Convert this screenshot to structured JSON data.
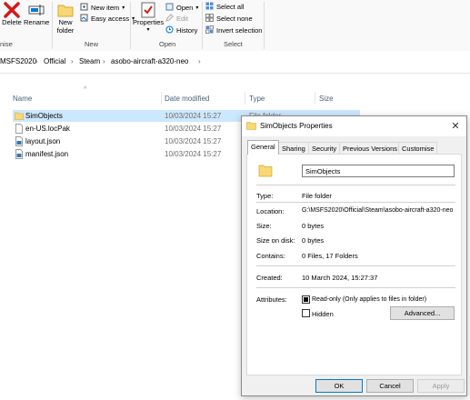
{
  "ribbon": {
    "delete_label": "Delete",
    "rename_label": "Rename",
    "organise_group": "nise",
    "new_folder_label": "New folder",
    "new_item_label": "New item",
    "easy_access_label": "Easy access",
    "new_group": "New",
    "properties_label": "Properties",
    "open_label": "Open",
    "edit_label": "Edit",
    "history_label": "History",
    "open_group": "Open",
    "select_all_label": "Select all",
    "select_none_label": "Select none",
    "invert_selection_label": "Invert selection",
    "select_group": "Select"
  },
  "breadcrumb": [
    "MSFS2020",
    "Official",
    "Steam",
    "asobo-aircraft-a320-neo"
  ],
  "columns": {
    "name": "Name",
    "date": "Date modified",
    "type": "Type",
    "size": "Size"
  },
  "files": [
    {
      "name": "SimObjects",
      "date": "10/03/2024 15:27",
      "type": "File folder",
      "icon": "folder-icon"
    },
    {
      "name": "en-US.locPak",
      "date": "10/03/2024 15:27",
      "type": "",
      "icon": "file-icon"
    },
    {
      "name": "layout.json",
      "date": "10/03/2024 15:27",
      "type": "",
      "icon": "json-file-icon"
    },
    {
      "name": "manifest.json",
      "date": "10/03/2024 15:27",
      "type": "",
      "icon": "json-file-icon"
    }
  ],
  "dialog": {
    "title": "SimObjects Properties",
    "close_glyph": "✕",
    "tabs": [
      "General",
      "Sharing",
      "Security",
      "Previous Versions",
      "Customise"
    ],
    "name_value": "SimObjects",
    "type_label": "Type:",
    "type_value": "File folder",
    "location_label": "Location:",
    "location_value": "G:\\MSFS2020\\Official\\Steam\\asobo-aircraft-a320-neo",
    "size_label": "Size:",
    "size_value": "0 bytes",
    "size_on_disk_label": "Size on disk:",
    "size_on_disk_value": "0 bytes",
    "contains_label": "Contains:",
    "contains_value": "0 Files, 17 Folders",
    "created_label": "Created:",
    "created_value": "10 March 2024, 15:27:37",
    "attributes_label": "Attributes:",
    "readonly_label": "Read-only (Only applies to files in folder)",
    "hidden_label": "Hidden",
    "advanced_label": "Advanced...",
    "ok_label": "OK",
    "cancel_label": "Cancel",
    "apply_label": "Apply"
  },
  "colors": {
    "accent": "#0078d7",
    "selection": "#cce8ff",
    "folder": "#f8d775",
    "delete_red": "#d21b1b"
  }
}
